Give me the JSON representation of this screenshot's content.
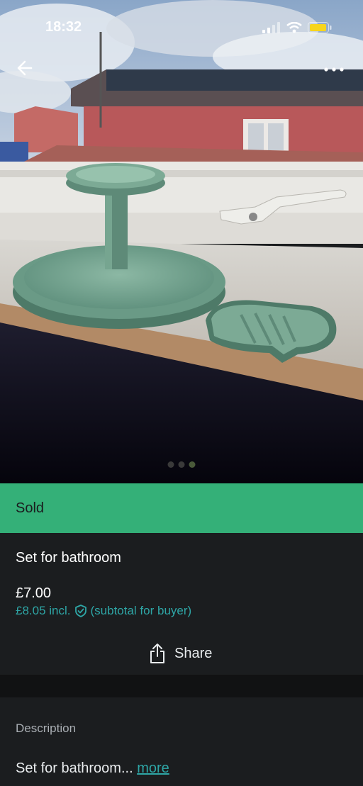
{
  "status_bar": {
    "time": "18:32",
    "battery_color": "#f7d51d"
  },
  "nav": {
    "back_icon": "back-arrow-icon",
    "more_icon": "more-dots-icon"
  },
  "gallery": {
    "image_count": 3,
    "active_index": 2
  },
  "listing": {
    "status": "Sold",
    "status_color": "#34b078",
    "title": "Set for bathroom",
    "price": "£7.00",
    "buyer_price": "£8.05 incl.",
    "buyer_note": "(subtotal for buyer)",
    "share_label": "Share"
  },
  "description": {
    "heading": "Description",
    "text": "Set for bathroom...",
    "more_label": "more"
  },
  "colors": {
    "accent": "#2ea6a6",
    "background": "#1b1d1f"
  }
}
